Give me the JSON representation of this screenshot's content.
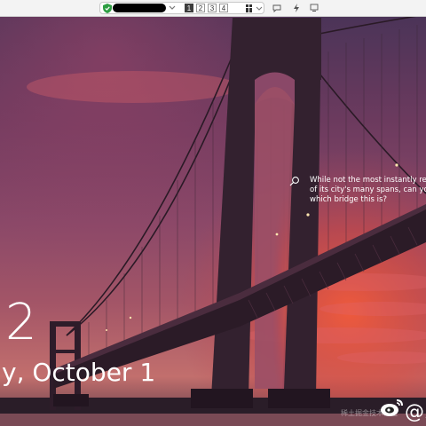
{
  "toolbar": {
    "tabs": [
      {
        "label": "1",
        "active": true
      },
      {
        "label": "2",
        "active": false
      },
      {
        "label": "3",
        "active": false
      },
      {
        "label": "4",
        "active": false
      }
    ],
    "icons": [
      "shield-check-icon",
      "grid-icon",
      "chevron-down-icon",
      "chat-icon",
      "bolt-icon",
      "monitor-icon"
    ]
  },
  "lockscreen": {
    "time": "2",
    "date": "y, October 1"
  },
  "spotlight": {
    "icon": "magnifier-icon",
    "lines": [
      "While not the most instantly recogn",
      "of its city's many spans, can you gu",
      "which bridge this is?"
    ]
  },
  "watermark": {
    "text": "稀土掘金技术社区",
    "at": "@系"
  },
  "colors": {
    "accent_shield": "#2e9e43",
    "active_tab": "#3d3d3d"
  }
}
